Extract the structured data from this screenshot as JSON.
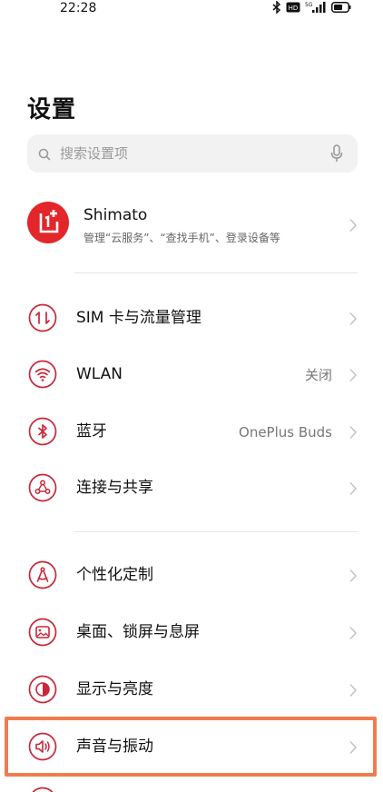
{
  "status_bar": {
    "time": "22:28",
    "icons": [
      "bluetooth-icon",
      "hd-icon",
      "5g-signal-icon",
      "battery-icon"
    ],
    "network_label": "5G",
    "hd_label": "HD"
  },
  "page": {
    "title": "设置"
  },
  "search": {
    "placeholder": "搜索设置项"
  },
  "account": {
    "name": "Shimato",
    "subtitle": "管理“云服务”、“查找手机”、登录设备等",
    "logo_color": "#e3262a"
  },
  "settings_groups": [
    [
      {
        "label": "SIM 卡与流量管理",
        "icon": "sim-data-icon",
        "value": ""
      },
      {
        "label": "WLAN",
        "icon": "wifi-icon",
        "value": "关闭"
      },
      {
        "label": "蓝牙",
        "icon": "bluetooth-icon",
        "value": "OnePlus Buds"
      },
      {
        "label": "连接与共享",
        "icon": "connection-sharing-icon",
        "value": ""
      }
    ],
    [
      {
        "label": "个性化定制",
        "icon": "personalization-icon",
        "value": ""
      },
      {
        "label": "桌面、锁屏与息屏",
        "icon": "home-lock-screen-icon",
        "value": ""
      },
      {
        "label": "显示与亮度",
        "icon": "display-brightness-icon",
        "value": ""
      },
      {
        "label": "声音与振动",
        "icon": "sound-vibration-icon",
        "value": ""
      }
    ]
  ],
  "colors": {
    "icon_accent": "#c8283a",
    "highlight": "#f07c4e",
    "search_bg": "#f2f2f2"
  }
}
